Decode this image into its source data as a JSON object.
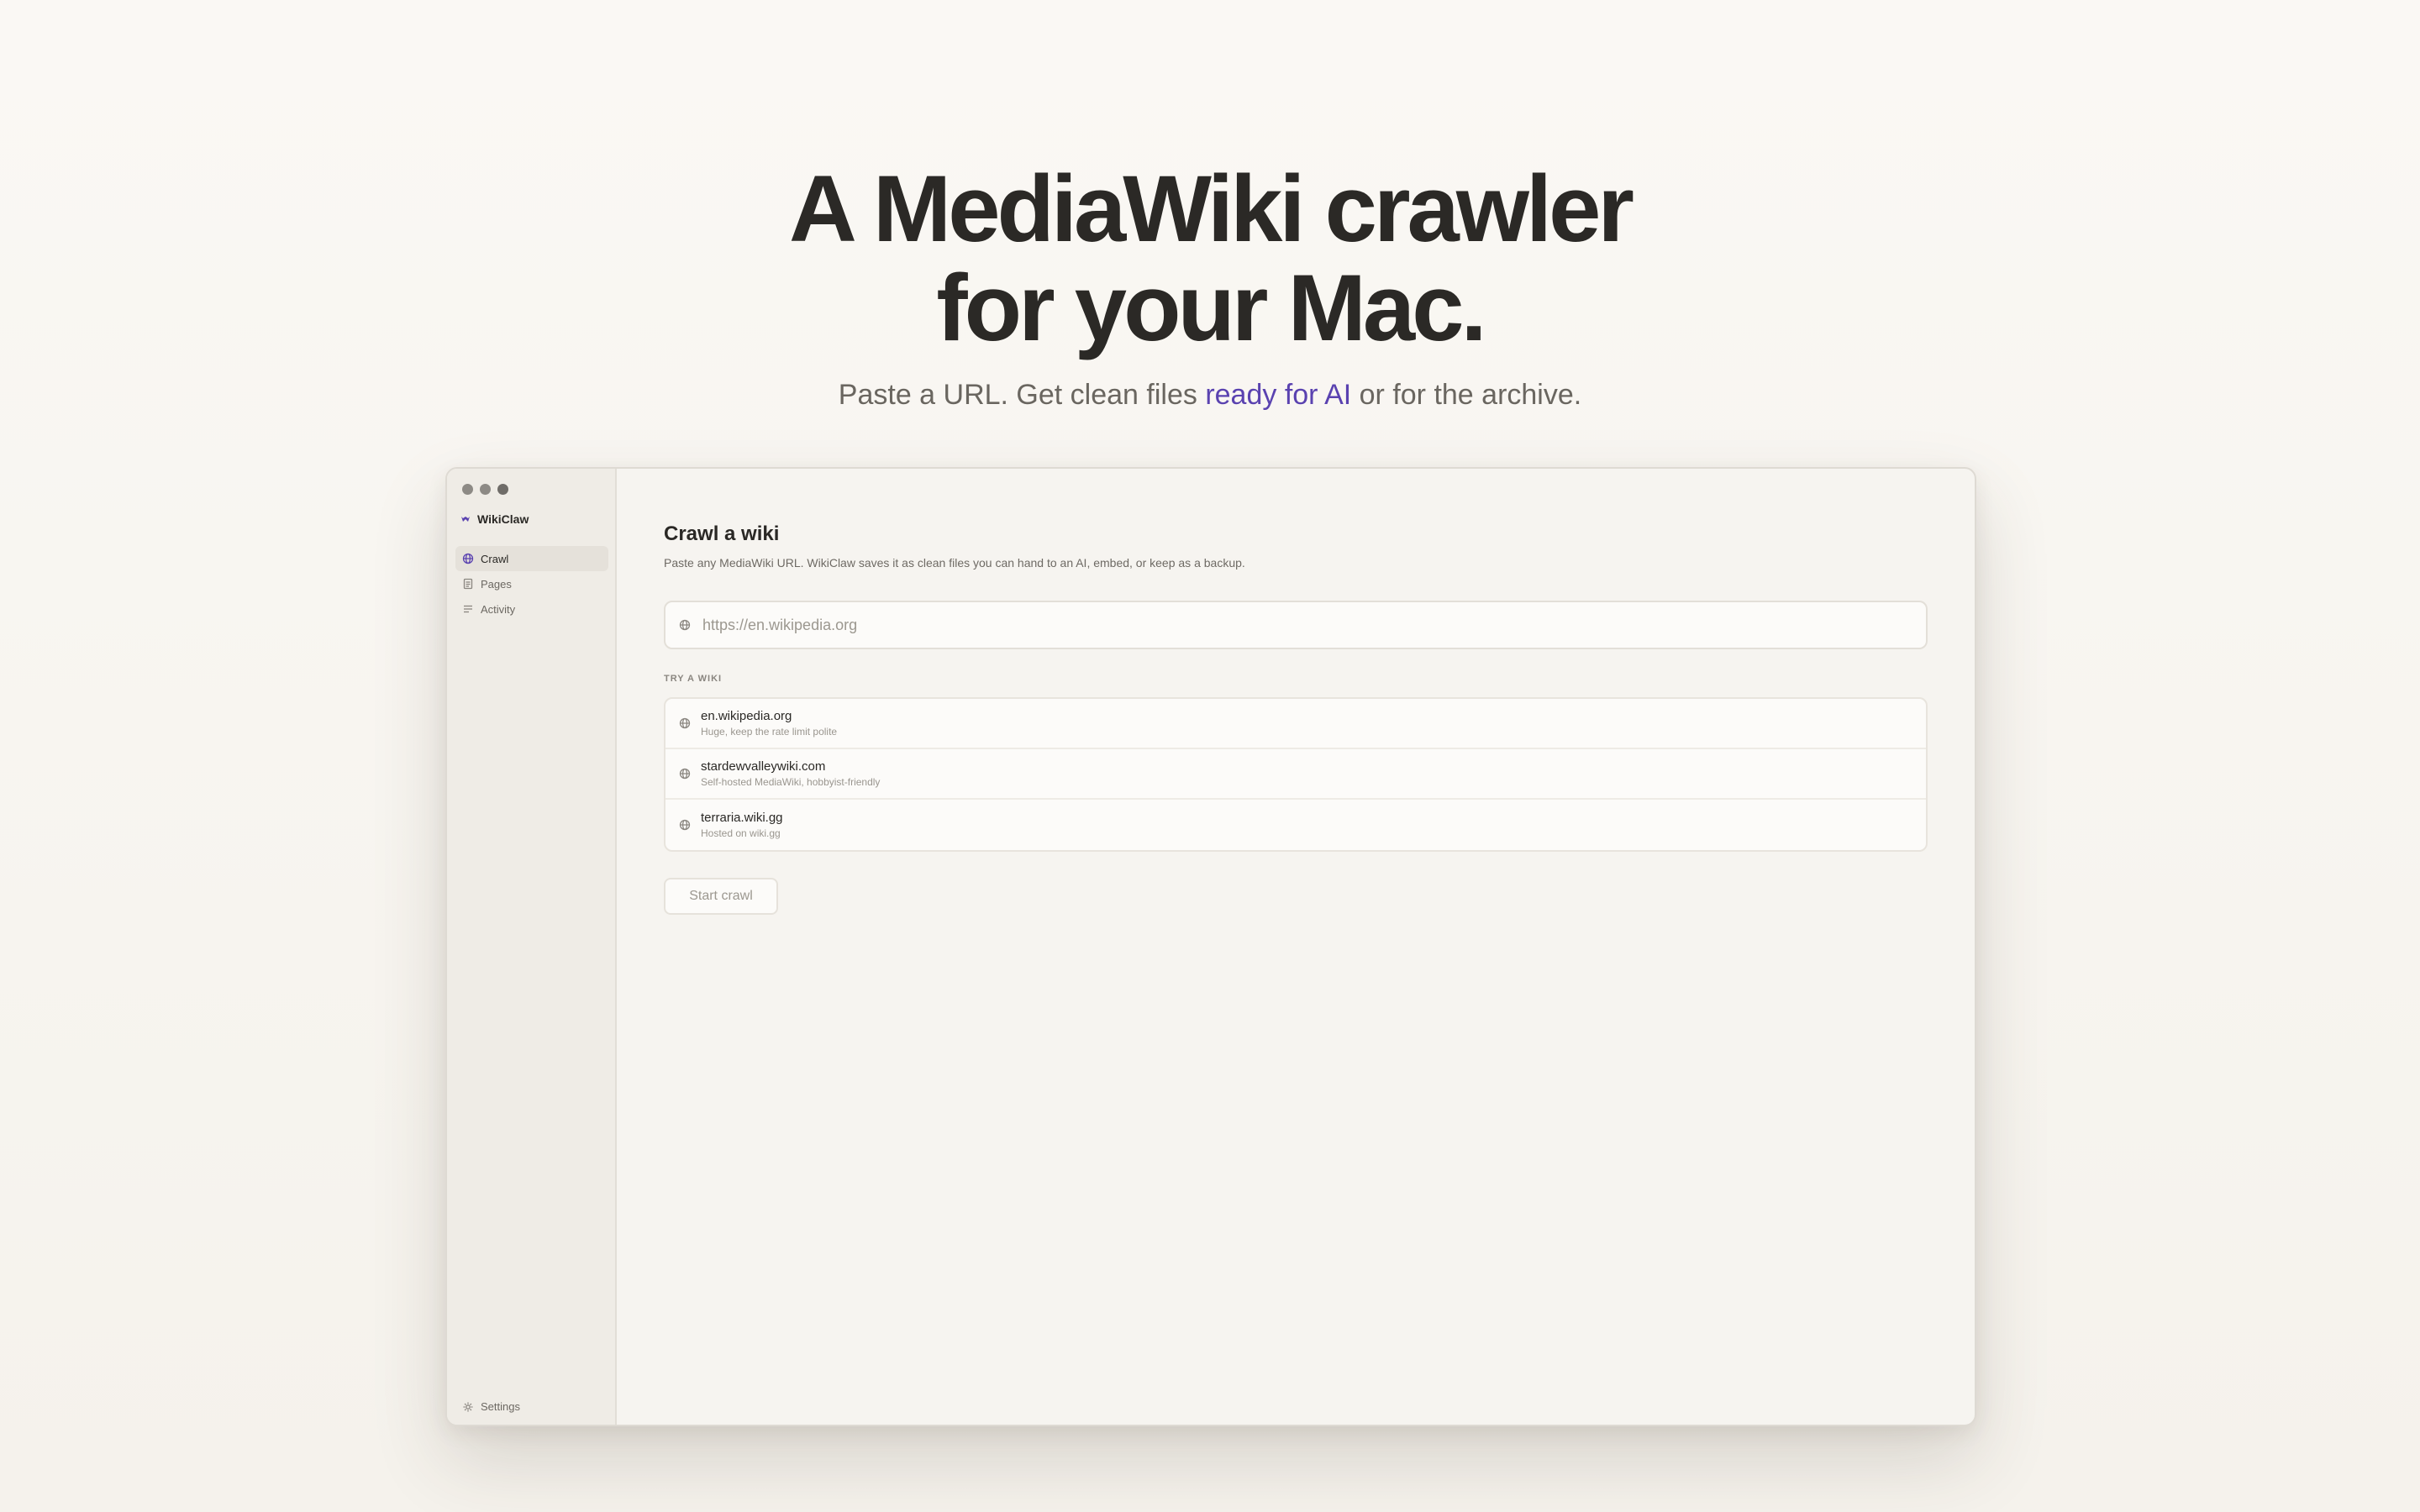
{
  "hero": {
    "title_line1": "A MediaWiki crawler",
    "title_line2": "for your Mac.",
    "subtitle_before": "Paste a URL. Get clean files ",
    "subtitle_accent": "ready for AI",
    "subtitle_after": " or for the archive."
  },
  "app": {
    "name": "WikiClaw",
    "sidebar": {
      "items": [
        {
          "label": "Crawl",
          "icon": "globe-icon",
          "active": true
        },
        {
          "label": "Pages",
          "icon": "document-icon",
          "active": false
        },
        {
          "label": "Activity",
          "icon": "list-icon",
          "active": false
        }
      ],
      "settings_label": "Settings"
    },
    "main": {
      "title": "Crawl a wiki",
      "description": "Paste any MediaWiki URL. WikiClaw saves it as clean files you can hand to an AI, embed, or keep as a backup.",
      "url_placeholder": "https://en.wikipedia.org",
      "url_value": "",
      "section_label": "TRY A WIKI",
      "wikis": [
        {
          "name": "en.wikipedia.org",
          "note": "Huge, keep the rate limit polite"
        },
        {
          "name": "stardewvalleywiki.com",
          "note": "Self-hosted MediaWiki, hobbyist-friendly"
        },
        {
          "name": "terraria.wiki.gg",
          "note": "Hosted on wiki.gg"
        }
      ],
      "start_button": "Start crawl"
    }
  },
  "colors": {
    "accent": "#5a42b0",
    "background": "#f8f6f1",
    "text": "#2a2825"
  }
}
